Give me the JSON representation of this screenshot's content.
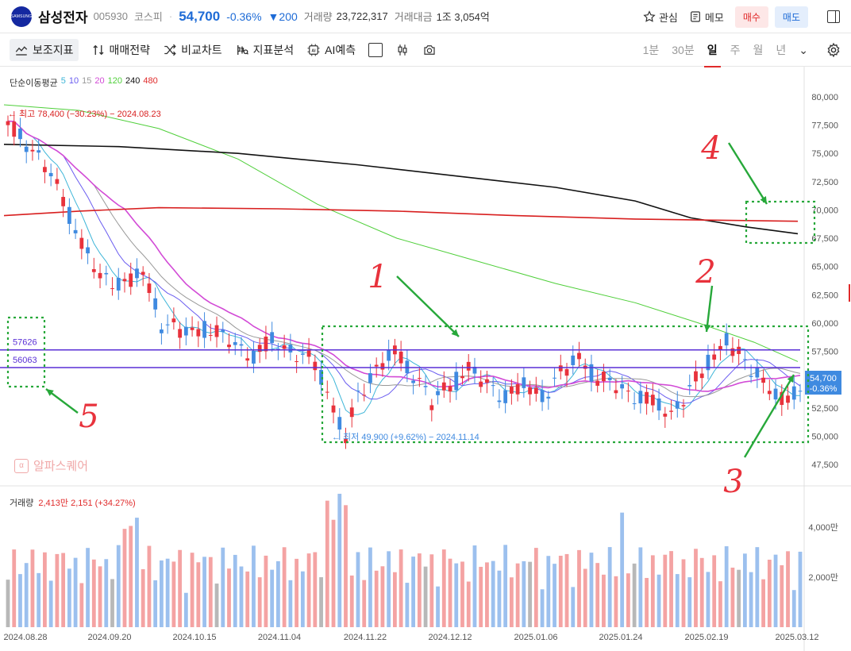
{
  "header": {
    "logo_text": "SAMSUNG",
    "name": "삼성전자",
    "code": "005930",
    "market": "코스피",
    "separator": "·",
    "price": "54,700",
    "change_pct": "-0.36%",
    "change_abs": "▼200",
    "volume_label": "거래량",
    "volume_value": "23,722,317",
    "amount_label": "거래대금",
    "amount_value": "1조 3,054억",
    "watch_label": "관심",
    "memo_label": "메모",
    "buy_label": "매수",
    "sell_label": "매도"
  },
  "toolbar": {
    "indicators": "보조지표",
    "strategy": "매매전략",
    "compare": "비교차트",
    "analysis": "지표분석",
    "ai": "AI예측",
    "periods": [
      "1분",
      "30분",
      "일",
      "주",
      "월",
      "년"
    ],
    "selected_period": "일"
  },
  "ma_legend": {
    "label": "단순이동평균",
    "items": [
      {
        "text": "5",
        "color": "#3db5d8"
      },
      {
        "text": "10",
        "color": "#6a5cf0"
      },
      {
        "text": "15",
        "color": "#999999"
      },
      {
        "text": "20",
        "color": "#d24ad6"
      },
      {
        "text": "120",
        "color": "#4fcf3a"
      },
      {
        "text": "240",
        "color": "#111111"
      },
      {
        "text": "480",
        "color": "#e02a2a"
      }
    ]
  },
  "chart_data": {
    "type": "candlestick",
    "y_ticks": [
      "80,000",
      "77,500",
      "75,000",
      "72,500",
      "70,000",
      "67,500",
      "65,000",
      "62,500",
      "60,000",
      "57,500",
      "55,000",
      "52,500",
      "50,000",
      "47,500"
    ],
    "ylim": [
      47500,
      80000
    ],
    "x_ticks": [
      "2024.08.28",
      "2024.09.20",
      "2024.10.15",
      "2024.11.04",
      "2024.11.22",
      "2024.12.12",
      "2025.01.06",
      "2025.01.24",
      "2025.02.19",
      "2025.03.12"
    ],
    "high_annotation": "← 최고 78,400 (−30.23%) − 2024.08.23",
    "low_annotation": "← 최저 49,900 (+9.62%) − 2024.11.14",
    "hlines": [
      {
        "label": "57626",
        "value": 57626
      },
      {
        "label": "56063",
        "value": 56063
      }
    ],
    "current_price_tag": "54,700",
    "current_change_tag": "-0.36%",
    "volume_ticks": [
      "4,000만",
      "2,000만"
    ],
    "annotations": [
      "1",
      "2",
      "3",
      "4",
      "5"
    ],
    "colors": {
      "up": "#e8323c",
      "down": "#3f8ae0",
      "up_vol": "#f4a3a3",
      "down_vol": "#9cc0ee",
      "hline": "#5a2fd6",
      "box": "#27a83a"
    }
  },
  "watermark": "알파스퀘어",
  "volume_legend": {
    "label": "거래량",
    "value": "2,413만 2,151 (+34.27%)"
  }
}
